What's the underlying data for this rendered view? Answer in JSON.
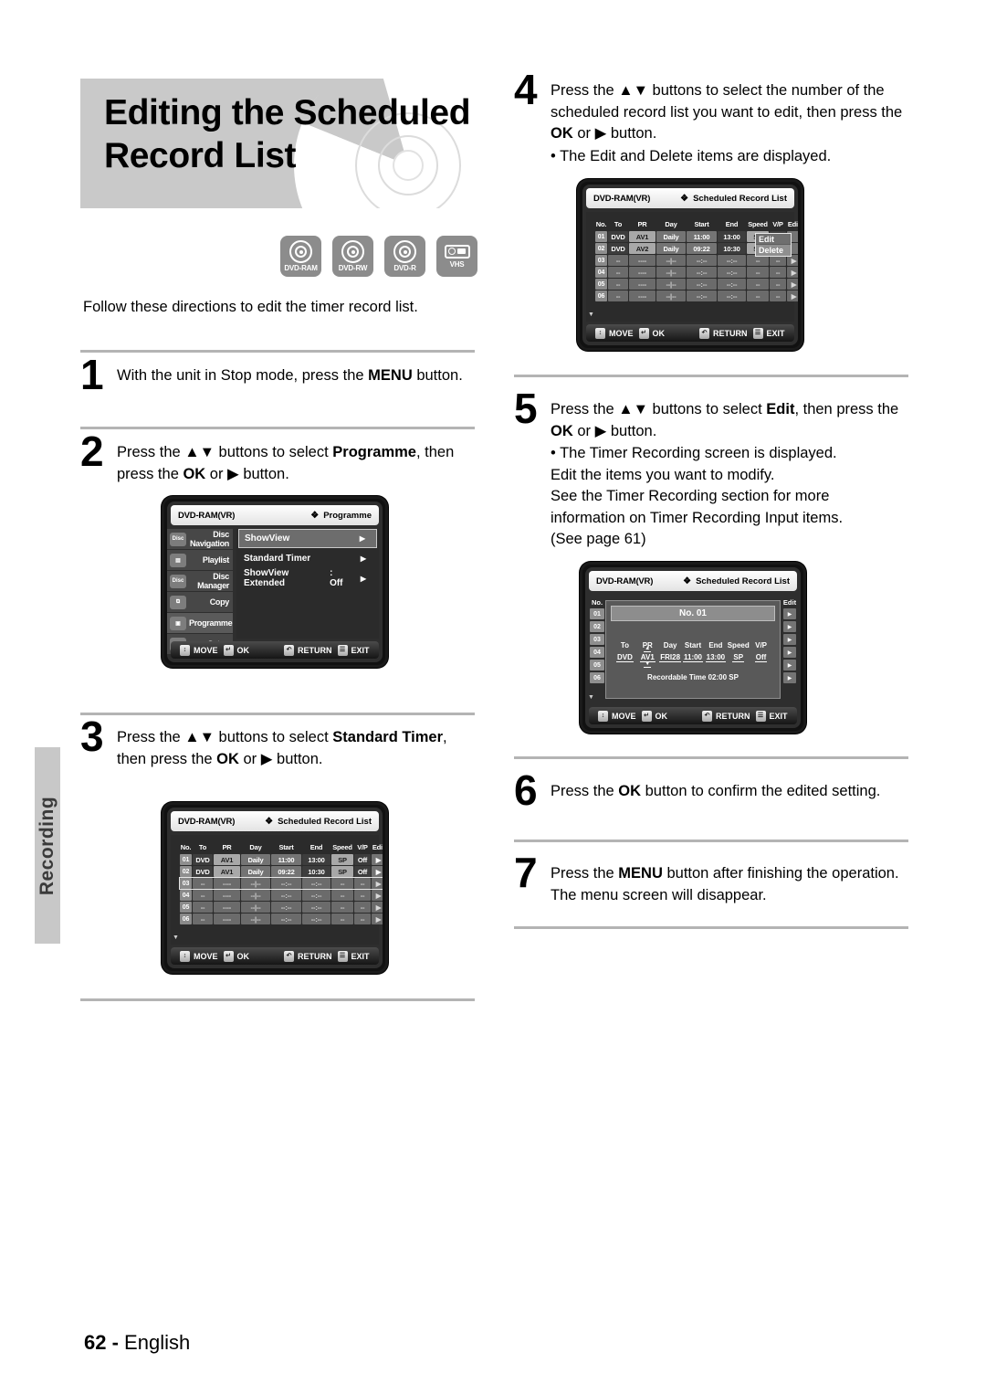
{
  "page": {
    "title_line1": "Editing the Scheduled",
    "title_line2": "Record List",
    "side_tab": "Recording",
    "intro": "Follow these directions to edit the timer record list.",
    "footer_page": "62 -",
    "footer_lang": "English"
  },
  "media_icons": [
    {
      "name": "dvd-ram-icon",
      "label": "DVD-RAM"
    },
    {
      "name": "dvd-rw-icon",
      "label": "DVD-RW"
    },
    {
      "name": "dvd-r-icon",
      "label": "DVD-R"
    },
    {
      "name": "vhs-icon",
      "label": "VHS"
    }
  ],
  "steps": {
    "s1": {
      "num": "1",
      "text_a": "With the unit in Stop mode, press the ",
      "bold_a": "MENU",
      "text_b": " button."
    },
    "s2": {
      "num": "2",
      "text_a": "Press the ▲▼ buttons to select ",
      "bold_a": "Programme",
      "text_b": ", then press the ",
      "bold_b": "OK",
      "text_c": " or ▶ button."
    },
    "s3": {
      "num": "3",
      "text_a": "Press the ▲▼ buttons to select ",
      "bold_a": "Standard Timer",
      "text_b": ", then press the ",
      "bold_b": "OK",
      "text_c": " or ▶ button."
    },
    "s4": {
      "num": "4",
      "text_a": "Press the ▲▼ buttons to select the number of the scheduled record list you want to edit, then press the ",
      "bold_a": "OK",
      "text_b": " or ▶ button.",
      "bullet": "• The Edit and Delete items are displayed."
    },
    "s5": {
      "num": "5",
      "text_a": "Press the ▲▼ buttons to select ",
      "bold_a": "Edit",
      "text_b": ", then press the ",
      "bold_b": "OK",
      "text_c": " or ▶ button.",
      "bullet1": "• The Timer Recording screen is displayed.",
      "bullet2": "Edit the items you want to modify.",
      "bullet3": "See the Timer Recording section for more",
      "bullet4": "information on Timer Recording Input items.",
      "bullet5": "(See page 61)"
    },
    "s6": {
      "num": "6",
      "text_a": "Press the ",
      "bold_a": "OK",
      "text_b": " button to confirm the edited setting."
    },
    "s7": {
      "num": "7",
      "text_a": "Press the ",
      "bold_a": "MENU",
      "text_b": " button after finishing the operation. The menu screen will disappear."
    }
  },
  "osd_common": {
    "disc_label": "DVD-RAM(VR)",
    "flower": "❖",
    "bar": {
      "move": "MOVE",
      "ok": "OK",
      "return": "RETURN",
      "exit": "EXIT",
      "move_key": "↕",
      "ok_key": "↵",
      "return_key": "↶",
      "exit_key": "☰"
    }
  },
  "osd_programme": {
    "heading": "Programme",
    "sidebar": [
      {
        "icon": "disc-navigation-icon",
        "label": "Disc Navigation"
      },
      {
        "icon": "playlist-icon",
        "label": "Playlist"
      },
      {
        "icon": "disc-manager-icon",
        "label": "Disc Manager"
      },
      {
        "icon": "copy-icon",
        "label": "Copy"
      },
      {
        "icon": "programme-icon",
        "label": "Programme"
      },
      {
        "icon": "setup-icon",
        "label": "Setup"
      }
    ],
    "menu": [
      {
        "label": "ShowView",
        "value": "",
        "selected": true
      },
      {
        "label": "Standard Timer",
        "value": "",
        "selected": false
      },
      {
        "label": "ShowView Extended",
        "value": ": Off",
        "selected": false
      }
    ]
  },
  "osd_schedule": {
    "heading": "Scheduled Record List",
    "columns": [
      "No.",
      "To",
      "PR",
      "Day",
      "Start",
      "End",
      "Speed",
      "V/P",
      "Edit"
    ],
    "rows_step3": [
      {
        "no": "01",
        "to": "DVD",
        "pr": "AV1",
        "day": "Daily",
        "start": "11:00",
        "end": "13:00",
        "speed": "SP",
        "vp": "Off",
        "edit": "▶"
      },
      {
        "no": "02",
        "to": "DVD",
        "pr": "AV1",
        "day": "Daily",
        "start": "09:22",
        "end": "10:30",
        "speed": "SP",
        "vp": "Off",
        "edit": "▶"
      },
      {
        "no": "03",
        "to": "--",
        "pr": "----",
        "day": "--|--",
        "start": "--:--",
        "end": "--:--",
        "speed": "--",
        "vp": "--",
        "edit": "▶"
      },
      {
        "no": "04",
        "to": "--",
        "pr": "----",
        "day": "--|--",
        "start": "--:--",
        "end": "--:--",
        "speed": "--",
        "vp": "--",
        "edit": "▶"
      },
      {
        "no": "05",
        "to": "--",
        "pr": "----",
        "day": "--|--",
        "start": "--:--",
        "end": "--:--",
        "speed": "--",
        "vp": "--",
        "edit": "▶"
      },
      {
        "no": "06",
        "to": "--",
        "pr": "----",
        "day": "--|--",
        "start": "--:--",
        "end": "--:--",
        "speed": "--",
        "vp": "--",
        "edit": "▶"
      }
    ],
    "rows_step4": [
      {
        "no": "01",
        "to": "DVD",
        "pr": "AV1",
        "day": "Daily",
        "start": "11:00",
        "end": "13:00",
        "speed": "SP",
        "vp": "",
        "edit": ""
      },
      {
        "no": "02",
        "to": "DVD",
        "pr": "AV2",
        "day": "Daily",
        "start": "09:22",
        "end": "10:30",
        "speed": "SP",
        "vp": "",
        "edit": ""
      },
      {
        "no": "03",
        "to": "--",
        "pr": "----",
        "day": "--|--",
        "start": "--:--",
        "end": "--:--",
        "speed": "--",
        "vp": "--",
        "edit": "▶"
      },
      {
        "no": "04",
        "to": "--",
        "pr": "----",
        "day": "--|--",
        "start": "--:--",
        "end": "--:--",
        "speed": "--",
        "vp": "--",
        "edit": "▶"
      },
      {
        "no": "05",
        "to": "--",
        "pr": "----",
        "day": "--|--",
        "start": "--:--",
        "end": "--:--",
        "speed": "--",
        "vp": "--",
        "edit": "▶"
      },
      {
        "no": "06",
        "to": "--",
        "pr": "----",
        "day": "--|--",
        "start": "--:--",
        "end": "--:--",
        "speed": "--",
        "vp": "--",
        "edit": "▶"
      }
    ],
    "popup": {
      "edit": "Edit",
      "delete": "Delete"
    },
    "scroll_up": "▲",
    "scroll_down": "▼"
  },
  "osd_edit": {
    "heading": "Scheduled Record List",
    "panel_title": "No. 01",
    "columns": [
      "To",
      "PR",
      "Day",
      "Start",
      "End",
      "Speed",
      "V/P"
    ],
    "values": [
      "DVD",
      "AV1",
      "FRI28",
      "11:00",
      "13:00",
      "SP",
      "Off"
    ],
    "recordable": "Recordable Time 02:00 SP",
    "side_header": "No.",
    "side_rows": [
      "01",
      "02",
      "03",
      "04",
      "05",
      "06"
    ],
    "edit_header": "Edit",
    "edit_rows": [
      "▶",
      "▶",
      "▶",
      "▶",
      "▶",
      "▶"
    ],
    "scroll_down": "▼"
  }
}
